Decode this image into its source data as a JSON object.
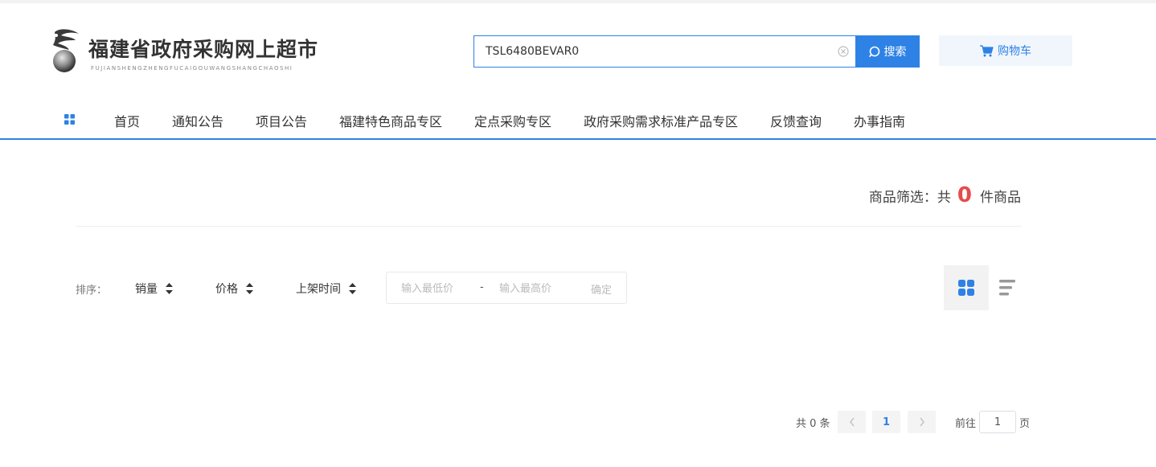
{
  "header": {
    "logo_title": "福建省政府采购网上超市",
    "logo_subtitle": "FUJIANSHENGZHENGFUCAIGOUWANGSHANGCHAOSHI",
    "search_value": "TSL6480BEVAR0",
    "search_button_label": "搜索",
    "cart_label": "购物车",
    "clear_icon": "close-circle-icon",
    "search_icon": "search-icon",
    "cart_icon": "cart-icon"
  },
  "nav": {
    "items": [
      "首页",
      "通知公告",
      "项目公告",
      "福建特色商品专区",
      "定点采购专区",
      "政府采购需求标准产品专区",
      "反馈查询",
      "办事指南"
    ]
  },
  "summary": {
    "prefix": "商品筛选：共",
    "count": "0",
    "suffix": "件商品"
  },
  "sort": {
    "label": "排序：",
    "options": [
      "销量",
      "价格",
      "上架时间"
    ],
    "price_min_placeholder": "输入最低价",
    "price_dash": "-",
    "price_max_placeholder": "输入最高价",
    "confirm_label": "确定"
  },
  "pagination": {
    "total": "共 0 条",
    "current_page": "1",
    "goto_label": "前往",
    "goto_value": "1",
    "page_suffix": "页"
  },
  "colors": {
    "accent": "#2e82e5",
    "count_red": "#e64b4b",
    "cart_bg": "#f1f6fd"
  }
}
